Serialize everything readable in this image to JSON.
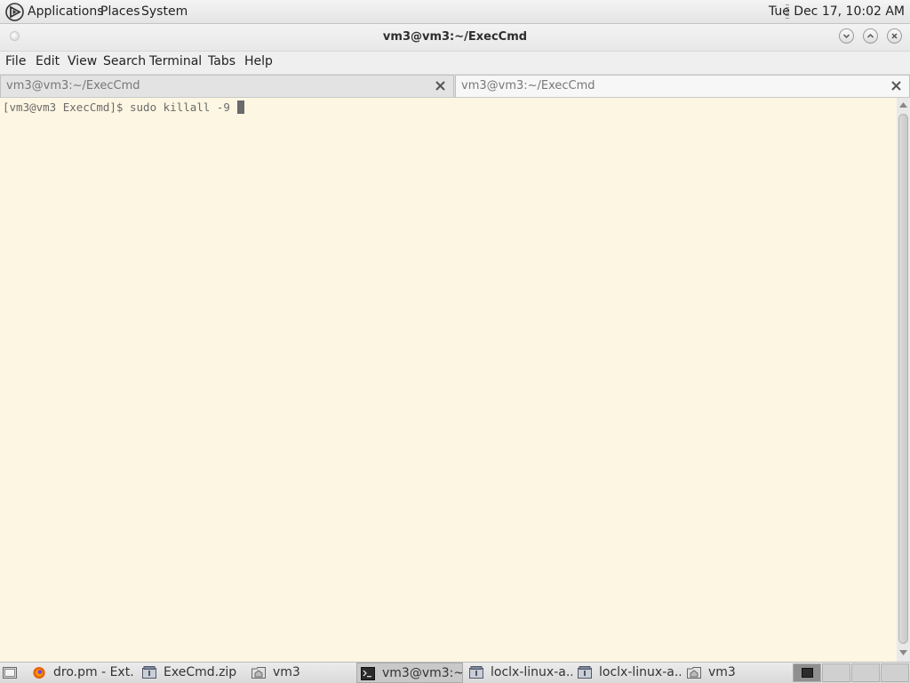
{
  "top_panel": {
    "menus": [
      "Applications",
      "Places",
      "System"
    ],
    "clock": "Tue Dec 17, 10:02 AM"
  },
  "window": {
    "title": "vm3@vm3:~/ExecCmd"
  },
  "menubar": {
    "items": [
      "File",
      "Edit",
      "View",
      "Search",
      "Terminal",
      "Tabs",
      "Help"
    ]
  },
  "tabs": [
    {
      "label": "vm3@vm3:~/ExecCmd",
      "active": false
    },
    {
      "label": "vm3@vm3:~/ExecCmd",
      "active": true
    }
  ],
  "terminal": {
    "prompt": "[vm3@vm3 ExecCmd]$ ",
    "command": "sudo killall -9 ",
    "background": "#fdf6e3"
  },
  "taskbar": {
    "tasks": [
      {
        "label": "dro.pm - Ext...",
        "icon": "firefox-icon"
      },
      {
        "label": "ExeCmd.zip",
        "icon": "archive-icon"
      },
      {
        "label": "vm3",
        "icon": "folder-icon"
      },
      {
        "label": "vm3@vm3:~...",
        "icon": "terminal-icon",
        "active": true
      },
      {
        "label": "loclx-linux-a...",
        "icon": "archive-icon"
      },
      {
        "label": "loclx-linux-a...",
        "icon": "archive-icon"
      },
      {
        "label": "vm3",
        "icon": "folder-icon"
      }
    ],
    "workspaces": 4,
    "current_workspace": 1
  }
}
